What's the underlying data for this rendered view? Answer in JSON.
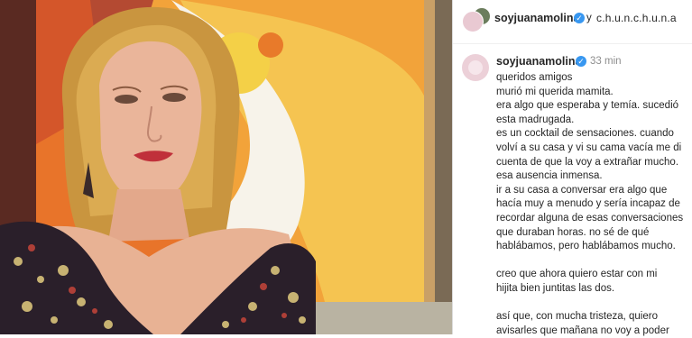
{
  "post": {
    "image_alt_subject": "woman-portrait-painting"
  },
  "header": {
    "username": "soyjuanamolina",
    "and_text": "y",
    "collaborator": "c.h.u.n.c.h.u.n.a"
  },
  "comment": {
    "username": "soyjuanamolina",
    "time": "33 min",
    "lines": [
      "queridos amigos",
      "murió mi querida mamita.",
      "era algo que esperaba y temía. sucedió",
      "esta madrugada.",
      "es un cocktail de sensaciones. cuando",
      "volví a su casa y vi su cama vacía me di",
      "cuenta de que la voy a extrañar mucho.",
      "esa ausencia inmensa.",
      "ir a su casa a conversar era algo que",
      "hacía muy a menudo y sería incapaz de",
      "recordar alguna de esas conversaciones",
      "que duraban horas. no sé de qué",
      "hablábamos, pero hablábamos mucho.",
      "",
      "creo que ahora quiero estar con mi",
      "hijita bien juntitas las dos.",
      "",
      "así que, con mucha tristeza, quiero",
      "avisarles que mañana no voy a poder"
    ]
  },
  "colors": {
    "verified": "#3897f0",
    "text": "#262626",
    "muted": "#8e8e8e"
  }
}
